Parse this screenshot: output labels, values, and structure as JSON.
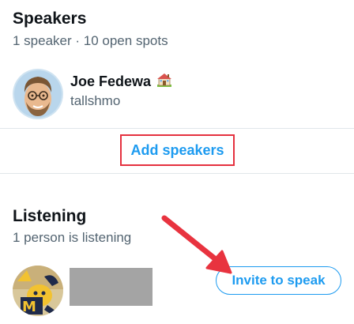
{
  "speakers": {
    "title": "Speakers",
    "subtitle": "1 speaker · 10 open spots",
    "items": [
      {
        "name": "Joe Fedewa",
        "badge_icon": "house-icon",
        "handle": "tallshmo"
      }
    ],
    "add_label": "Add speakers"
  },
  "listening": {
    "title": "Listening",
    "subtitle": "1 person is listening",
    "invite_label": "Invite to speak"
  },
  "colors": {
    "accent": "#1d9bf0",
    "highlight": "#e5313f",
    "annotation_arrow": "#e8333f"
  }
}
